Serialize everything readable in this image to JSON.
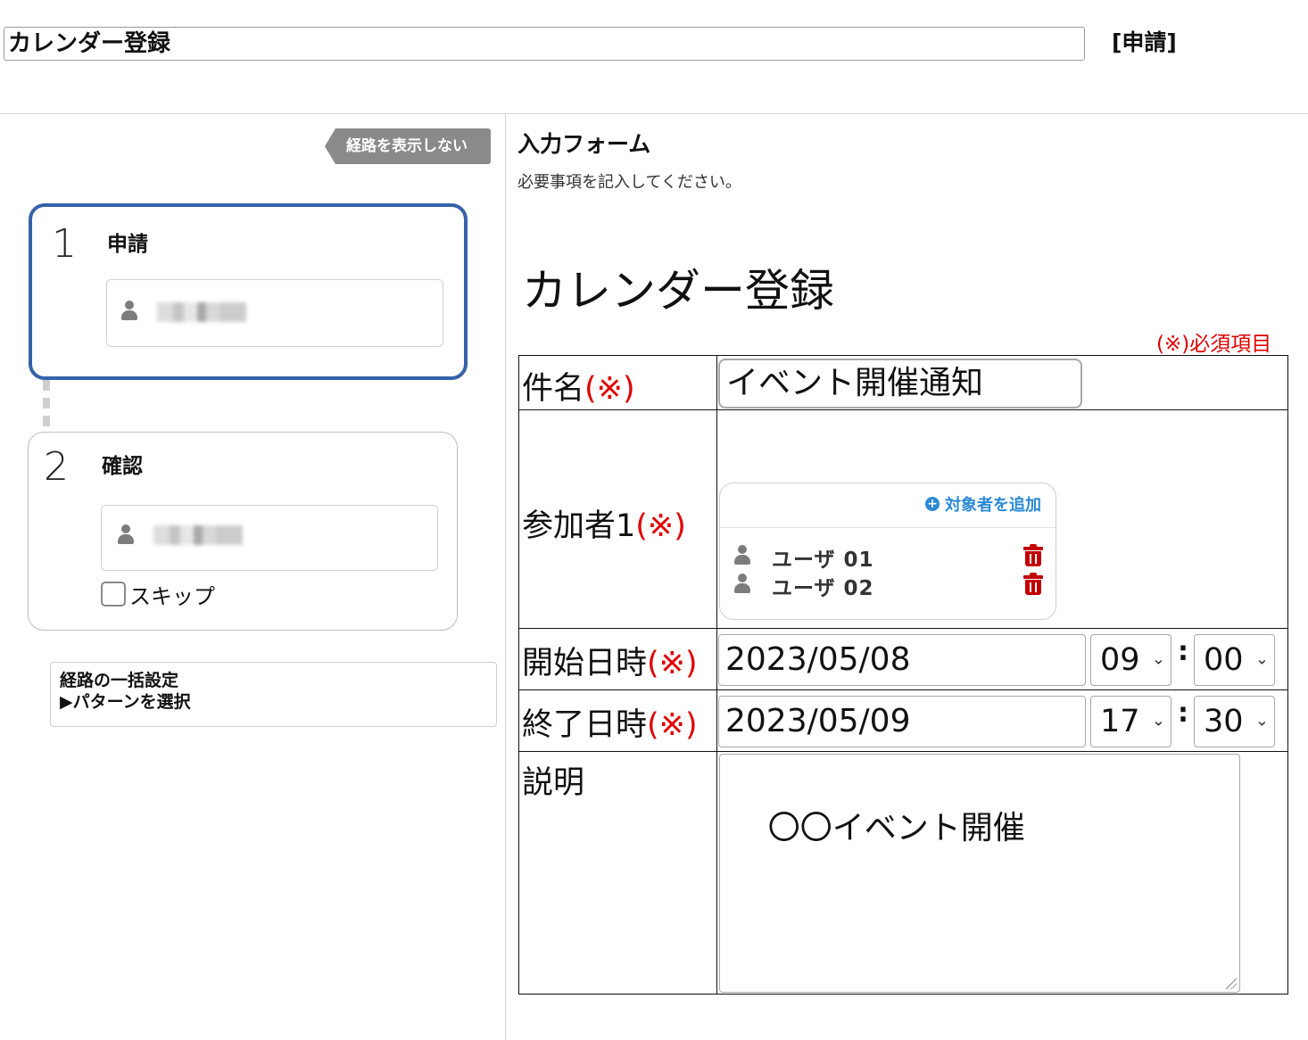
{
  "header": {
    "title": "カレンダー登録",
    "form_type": "[申請]"
  },
  "route": {
    "toggle_label": "経路を表示しない",
    "steps": [
      {
        "number": "1",
        "title": "申請",
        "active": true
      },
      {
        "number": "2",
        "title": "確認",
        "active": false,
        "skip_label": "スキップ",
        "skip_checked": false
      }
    ],
    "bulk_setting": {
      "title": "経路の一括設定",
      "pattern_link": "▶パターンを選択"
    }
  },
  "form": {
    "section_title": "入力フォーム",
    "section_desc": "必要事項を記入してください。",
    "heading": "カレンダー登録",
    "required_legend": "(※)必須項目",
    "required_mark": "(※)",
    "fields": {
      "subject": {
        "label": "件名",
        "value": "イベント開催通知"
      },
      "participants": {
        "label": "参加者1",
        "add_label": "対象者を追加",
        "users": [
          "ユーザ 01",
          "ユーザ 02"
        ]
      },
      "start": {
        "label": "開始日時",
        "date": "2023/05/08",
        "hour": "09",
        "minute": "00"
      },
      "end": {
        "label": "終了日時",
        "date": "2023/05/09",
        "hour": "17",
        "minute": "30"
      },
      "description": {
        "label": "説明",
        "value": "〇〇イベント開催"
      }
    },
    "time_separator": ":"
  },
  "colors": {
    "active_step_border": "#3562a8",
    "required_red": "#e00000",
    "link_blue": "#2a8ad4",
    "trash_red": "#c10000"
  }
}
